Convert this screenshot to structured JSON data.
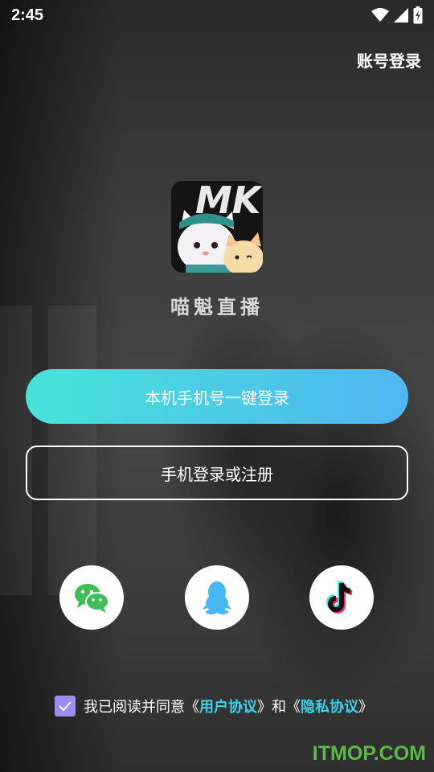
{
  "status_bar": {
    "time": "2:45"
  },
  "header": {
    "account_login_label": "账号登录"
  },
  "app": {
    "name": "喵魁直播",
    "logo_text": "MK"
  },
  "buttons": {
    "one_click_login": "本机手机号一键登录",
    "phone_login_register": "手机登录或注册"
  },
  "social_logins": [
    {
      "name": "wechat",
      "icon": "wechat-icon",
      "color": "#3dbf56"
    },
    {
      "name": "qq",
      "icon": "qq-penguin-icon",
      "color": "#45b8f5"
    },
    {
      "name": "douyin",
      "icon": "tiktok-icon",
      "color": "#111111"
    }
  ],
  "agreement": {
    "checked": true,
    "prefix": "我已阅读并同意《",
    "user_agreement": "用户协议",
    "middle": "》和《",
    "privacy_agreement": "隐私协议",
    "suffix": "》"
  },
  "watermark": "ITMOP.COM",
  "colors": {
    "primary_gradient_start": "#47e3d8",
    "primary_gradient_end": "#4fb6f2",
    "link": "#3fd0ea",
    "checkbox": "#9b8cf2"
  }
}
